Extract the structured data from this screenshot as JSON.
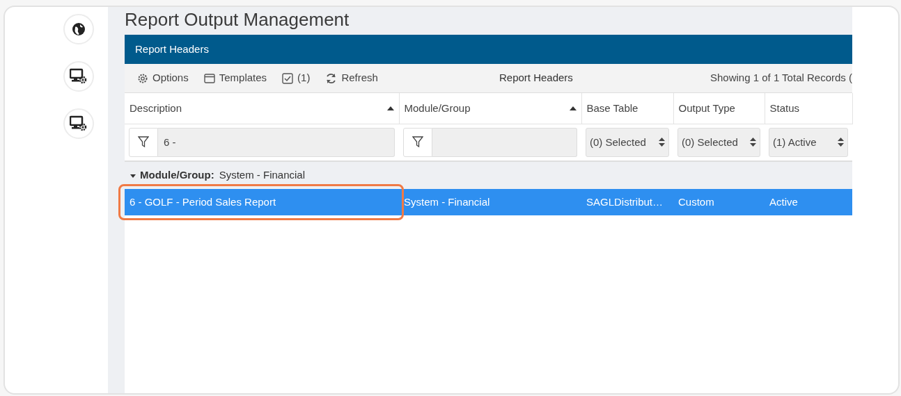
{
  "page_title": "Report Output Management",
  "sidebar": {
    "icons": [
      {
        "kind": "globe"
      },
      {
        "kind": "monitor-gear"
      },
      {
        "kind": "monitor-gear"
      }
    ]
  },
  "panel": {
    "title": "Report Headers",
    "toolbar": {
      "buttons": [
        {
          "kind": "gear",
          "label": "Options"
        },
        {
          "kind": "window",
          "label": "Templates"
        },
        {
          "kind": "checkbox",
          "label": "(1)"
        },
        {
          "kind": "refresh",
          "label": "Refresh"
        }
      ],
      "caption": "Report Headers",
      "record_count": "Showing 1 of 1 Total Records ("
    },
    "columns": [
      {
        "label": "Description",
        "sorted": true
      },
      {
        "label": "Module/Group",
        "sorted": true
      },
      {
        "label": "Base Table",
        "sorted": false
      },
      {
        "label": "Output Type",
        "sorted": false
      },
      {
        "label": "Status",
        "sorted": false
      }
    ],
    "filters": [
      {
        "kind": "text",
        "value": "6 -"
      },
      {
        "kind": "text"
      },
      {
        "kind": "select",
        "value": "(0) Selected"
      },
      {
        "kind": "select",
        "value": "(0) Selected"
      },
      {
        "kind": "select",
        "value": "(1) Active"
      }
    ],
    "groups": [
      {
        "label": "Module/Group:",
        "value": "System - Financial",
        "expanded": true,
        "rows": [
          {
            "selected": true,
            "cells": [
              {
                "text": "6 - GOLF - Period Sales Report",
                "highlighted": true
              },
              {
                "text": "System - Financial",
                "highlighted": false
              },
              {
                "text": "SAGLDistribut…",
                "highlighted": false
              },
              {
                "text": "Custom",
                "highlighted": false
              },
              {
                "text": "Active",
                "highlighted": false
              }
            ]
          }
        ]
      }
    ]
  }
}
